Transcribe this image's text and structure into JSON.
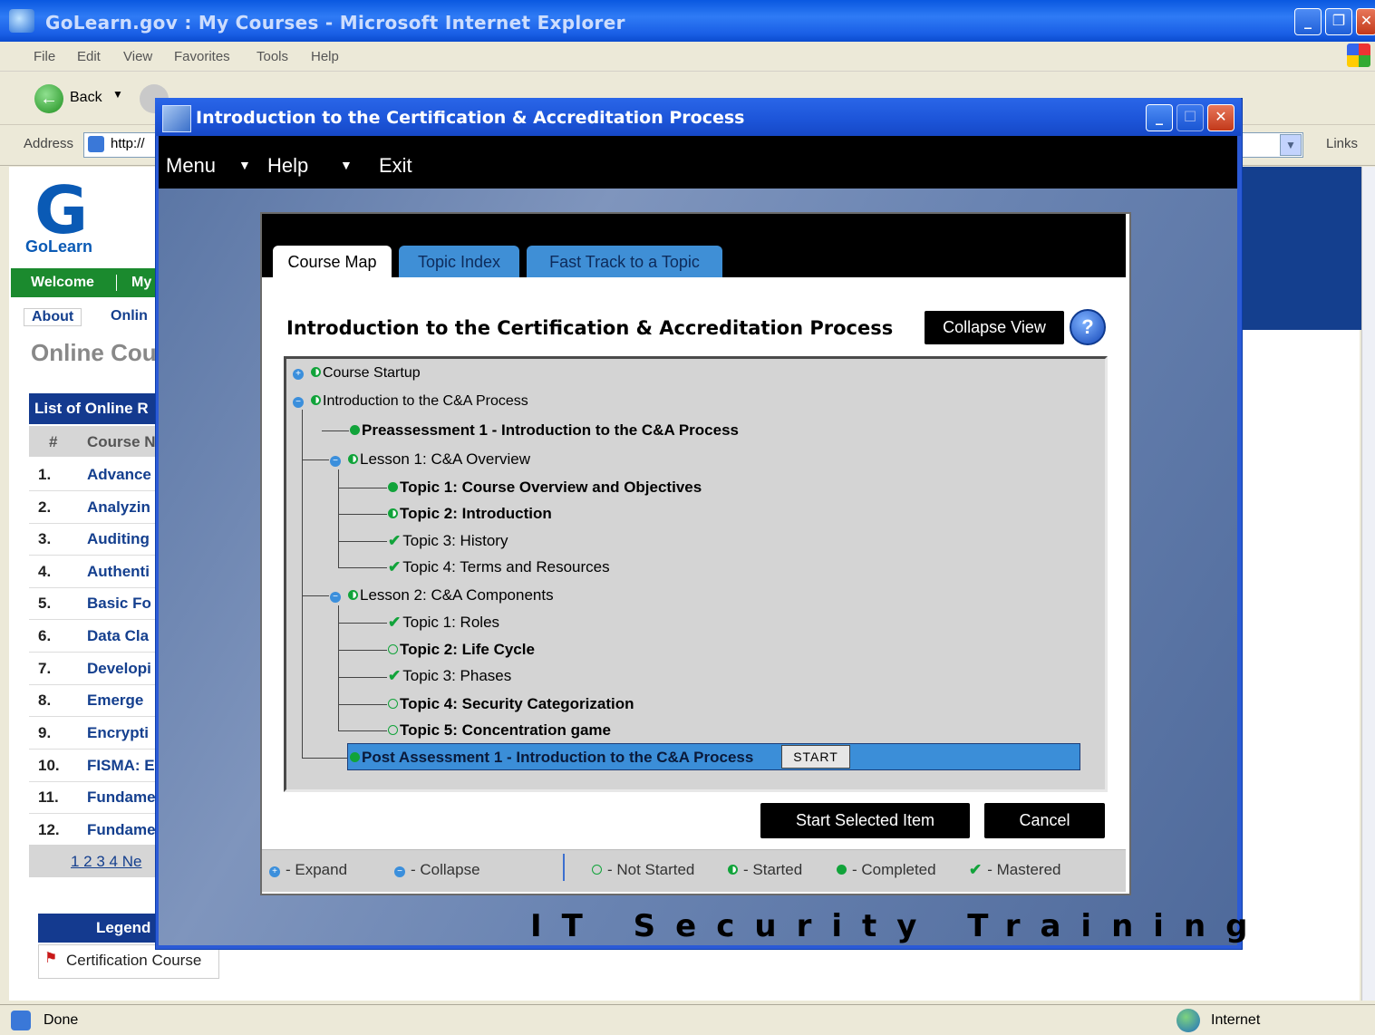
{
  "ie": {
    "title": "GoLearn.gov : My Courses - Microsoft Internet Explorer",
    "menu": [
      "File",
      "Edit",
      "View",
      "Favorites",
      "Tools",
      "Help"
    ],
    "back_label": "Back",
    "address_label": "Address",
    "address_value": "http://",
    "links_label": "Links",
    "status_text": "Done",
    "zone_text": "Internet"
  },
  "golearn": {
    "logo_letter": "G",
    "logo_text": "GoLearn",
    "nav": [
      "Welcome",
      "My"
    ],
    "subnav": [
      "About",
      "Onlin"
    ],
    "heading": "Online Cou",
    "list_header": "List of Online R",
    "col_num": "#",
    "col_course": "Course N",
    "rows": [
      {
        "n": "1.",
        "c": "Advance"
      },
      {
        "n": "2.",
        "c": "Analyzin"
      },
      {
        "n": "3.",
        "c": "Auditing"
      },
      {
        "n": "4.",
        "c": "Authenti"
      },
      {
        "n": "5.",
        "c": "Basic Fo"
      },
      {
        "n": "6.",
        "c": "Data Cla"
      },
      {
        "n": "7.",
        "c": "Developi"
      },
      {
        "n": "8.",
        "c": "Emerge"
      },
      {
        "n": "9.",
        "c": "Encrypti"
      },
      {
        "n": "10.",
        "c": "FISMA: E"
      },
      {
        "n": "11.",
        "c": "Fundame"
      },
      {
        "n": "12.",
        "c": "Fundame"
      }
    ],
    "pager": "1 2 3 4  Ne",
    "legend_title": "Legend",
    "legend_item": "Certification Course"
  },
  "course_window": {
    "title": "Introduction to the Certification & Accreditation Process",
    "menu": [
      "Menu",
      "Help",
      "Exit"
    ],
    "tabs": [
      "Course Map",
      "Topic Index",
      "Fast Track to a Topic"
    ],
    "heading": "Introduction to the Certification & Accreditation Process",
    "collapse_label": "Collapse View",
    "help_glyph": "?",
    "tree": [
      {
        "label": "Course Startup",
        "status": "started",
        "bold": false
      },
      {
        "label": "Introduction to the C&A Process",
        "status": "started",
        "bold": false
      },
      {
        "label": "Preassessment 1 - Introduction to the C&A Process",
        "status": "completed",
        "bold": true
      },
      {
        "label": "Lesson 1: C&A Overview",
        "status": "started",
        "bold": false
      },
      {
        "label": "Topic 1: Course Overview and Objectives",
        "status": "completed",
        "bold": true
      },
      {
        "label": "Topic 2: Introduction",
        "status": "started",
        "bold": true
      },
      {
        "label": "Topic 3: History",
        "status": "mastered",
        "bold": false
      },
      {
        "label": "Topic 4: Terms and Resources",
        "status": "mastered",
        "bold": false
      },
      {
        "label": "Lesson 2: C&A Components",
        "status": "started",
        "bold": false
      },
      {
        "label": "Topic 1: Roles",
        "status": "mastered",
        "bold": false
      },
      {
        "label": "Topic 2: Life Cycle",
        "status": "not-started",
        "bold": true
      },
      {
        "label": "Topic 3: Phases",
        "status": "mastered",
        "bold": false
      },
      {
        "label": "Topic 4: Security Categorization",
        "status": "not-started",
        "bold": true
      },
      {
        "label": "Topic 5: Concentration game",
        "status": "not-started",
        "bold": true
      },
      {
        "label": "Post Assessment 1 - Introduction to the C&A Process",
        "status": "completed",
        "bold": true
      }
    ],
    "start_label": "START",
    "start_selected_label": "Start Selected Item",
    "cancel_label": "Cancel",
    "legend": {
      "expand": "- Expand",
      "collapse": "- Collapse",
      "not_started": "- Not Started",
      "started": "- Started",
      "completed": "- Completed",
      "mastered": "- Mastered"
    },
    "footer_text": "IT Security Training",
    "colors": {
      "accent": "#3b8ed8",
      "status_green": "#11a33a",
      "window_blue": "#2b5ad6"
    }
  }
}
